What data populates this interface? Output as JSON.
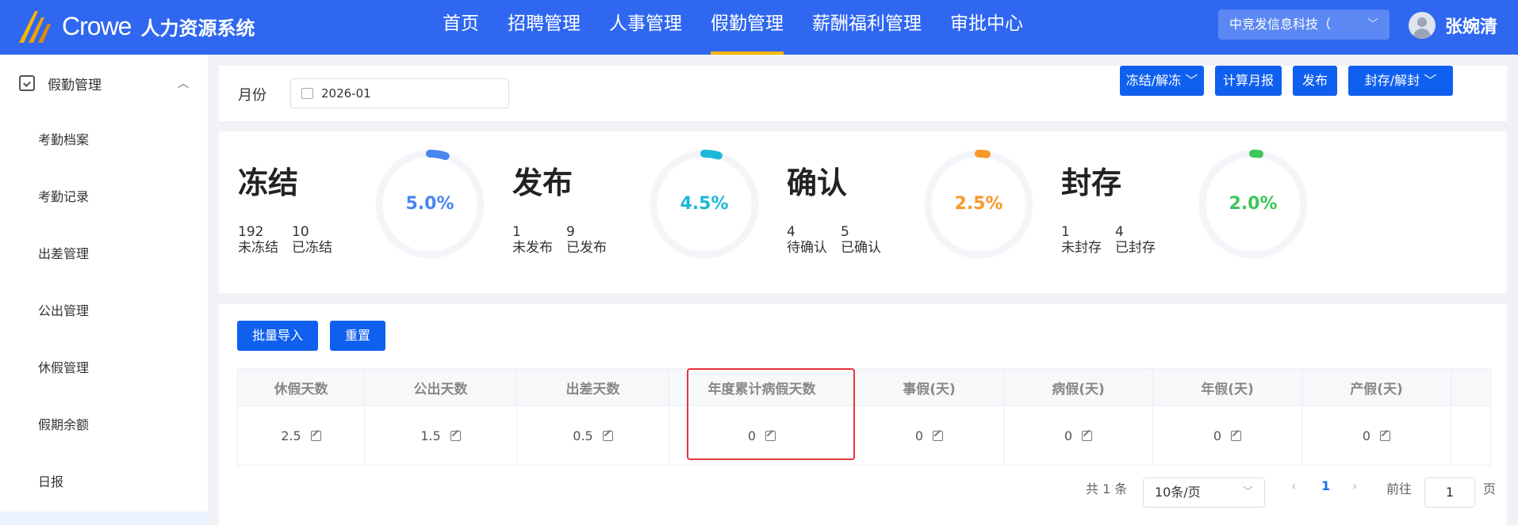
{
  "header": {
    "logo_text": "Crowe",
    "system_name": "人力资源系统",
    "nav": [
      "首页",
      "招聘管理",
      "人事管理",
      "假勤管理",
      "薪酬福利管理",
      "审批中心"
    ],
    "company": "中竞发信息科技（",
    "user": "张婉清",
    "colors": {
      "bar": "#2f67f0",
      "active_underline": "#f7b500"
    }
  },
  "sidebar": {
    "group": "假勤管理",
    "items": [
      "考勤档案",
      "考勤记录",
      "出差管理",
      "公出管理",
      "休假管理",
      "假期余额",
      "日报"
    ]
  },
  "filter": {
    "month_label": "月份",
    "month_value": "2026-01",
    "buttons": [
      "冻结/解冻",
      "计算月报",
      "发布",
      "封存/解封"
    ]
  },
  "stats": [
    {
      "title": "冻结",
      "n1": "192",
      "l1": "未冻结",
      "n2": "10",
      "l2": "已冻结",
      "percent": "5.0%",
      "fraction": 0.05,
      "color": "#4a86f0"
    },
    {
      "title": "发布",
      "n1": "1",
      "l1": "未发布",
      "n2": "9",
      "l2": "已发布",
      "percent": "4.5%",
      "fraction": 0.045,
      "color": "#1db8d8"
    },
    {
      "title": "确认",
      "n1": "4",
      "l1": "待确认",
      "n2": "5",
      "l2": "已确认",
      "percent": "2.5%",
      "fraction": 0.025,
      "color": "#f7992a"
    },
    {
      "title": "封存",
      "n1": "1",
      "l1": "未封存",
      "n2": "4",
      "l2": "已封存",
      "percent": "2.0%",
      "fraction": 0.02,
      "color": "#3fc55a"
    }
  ],
  "table": {
    "buttons": [
      "批量导入",
      "重置"
    ],
    "headers": [
      "休假天数",
      "公出天数",
      "出差天数",
      "年度累计病假天数",
      "事假(天)",
      "病假(天)",
      "年假(天)",
      "产假(天)"
    ],
    "row": [
      "2.5",
      "1.5",
      "0.5",
      "0",
      "0",
      "0",
      "0",
      "0"
    ]
  },
  "pagination": {
    "total": "共 1 条",
    "page_size": "10条/页",
    "current_page": "1",
    "goto_label": "前往",
    "goto_value": "1",
    "page_suffix": "页"
  }
}
